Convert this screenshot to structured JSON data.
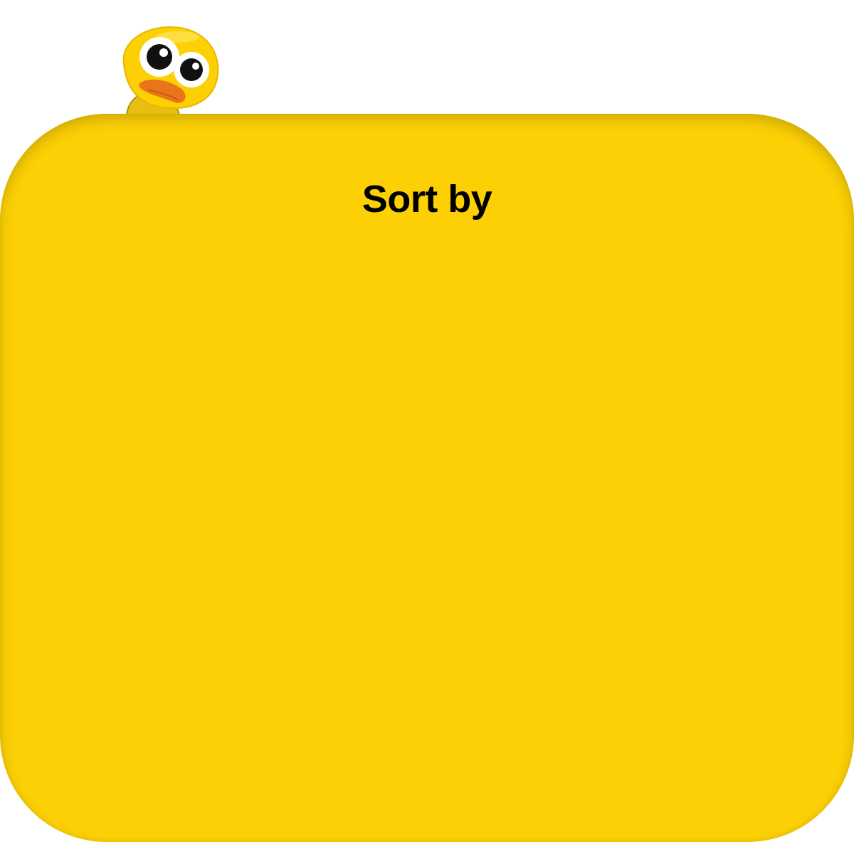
{
  "sheet": {
    "title": "Sort by",
    "background_color": "#fcd005"
  },
  "mascot": {
    "icon": "duck-mascot-icon"
  }
}
